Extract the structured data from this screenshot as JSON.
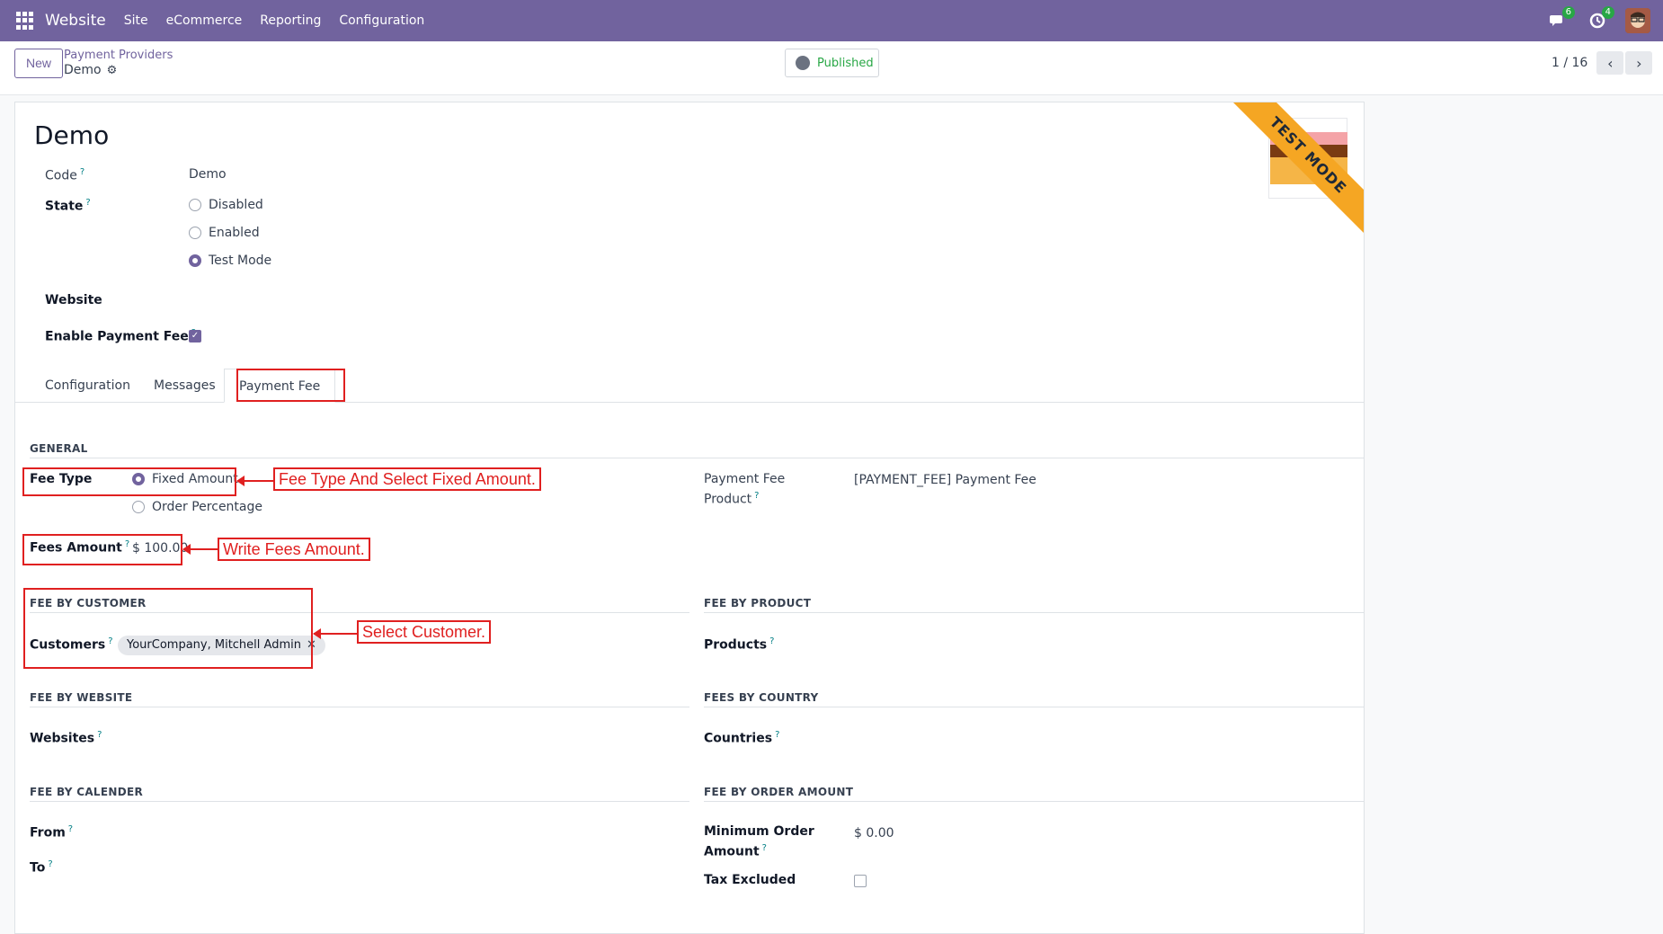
{
  "navbar": {
    "app": "Website",
    "menu": [
      "Site",
      "eCommerce",
      "Reporting",
      "Configuration"
    ],
    "messages_badge": "6",
    "activities_badge": "4"
  },
  "control": {
    "new_label": "New",
    "breadcrumb_parent": "Payment Providers",
    "breadcrumb_current": "Demo",
    "published_label": "Published",
    "pager": "1 / 16"
  },
  "form": {
    "title": "Demo",
    "ribbon": "TEST MODE",
    "code_label": "Code",
    "code_value": "Demo",
    "state_label": "State",
    "state_options": [
      "Disabled",
      "Enabled",
      "Test Mode"
    ],
    "state_selected": "Test Mode",
    "website_label": "Website",
    "enable_fee_label": "Enable Payment Fee",
    "enable_fee_checked": true
  },
  "tabs": [
    "Configuration",
    "Messages",
    "Payment Fee"
  ],
  "active_tab": "Payment Fee",
  "payment_fee": {
    "general_header": "GENERAL",
    "fee_type_label": "Fee Type",
    "fee_type_options": [
      "Fixed Amount",
      "Order Percentage"
    ],
    "fee_type_selected": "Fixed Amount",
    "fees_amount_label": "Fees Amount",
    "fees_amount_value": "$ 100.00",
    "product_label_1": "Payment Fee",
    "product_label_2": "Product",
    "product_value": "[PAYMENT_FEE] Payment Fee",
    "fee_by_customer_header": "FEE BY CUSTOMER",
    "customers_label": "Customers",
    "customer_tag": "YourCompany, Mitchell Admin",
    "fee_by_product_header": "FEE BY PRODUCT",
    "products_label": "Products",
    "fee_by_website_header": "FEE BY WEBSITE",
    "websites_label": "Websites",
    "fees_by_country_header": "FEES BY COUNTRY",
    "countries_label": "Countries",
    "fee_by_calender_header": "FEE BY CALENDER",
    "from_label": "From",
    "to_label": "To",
    "fee_by_order_amount_header": "FEE BY ORDER AMOUNT",
    "min_order_label_1": "Minimum Order",
    "min_order_label_2": "Amount",
    "min_order_value": "$ 0.00",
    "tax_excluded_label": "Tax Excluded",
    "tax_excluded_checked": false
  },
  "annotations": {
    "fee_type_note": "Fee Type And Select Fixed Amount.",
    "fees_amount_note": "Write Fees Amount.",
    "customer_note": "Select Customer."
  },
  "colors": {
    "navbar": "#71639e",
    "accent": "#71639e",
    "annotation": "#e02020",
    "ribbon": "#f5a623",
    "help": "#017e84"
  }
}
